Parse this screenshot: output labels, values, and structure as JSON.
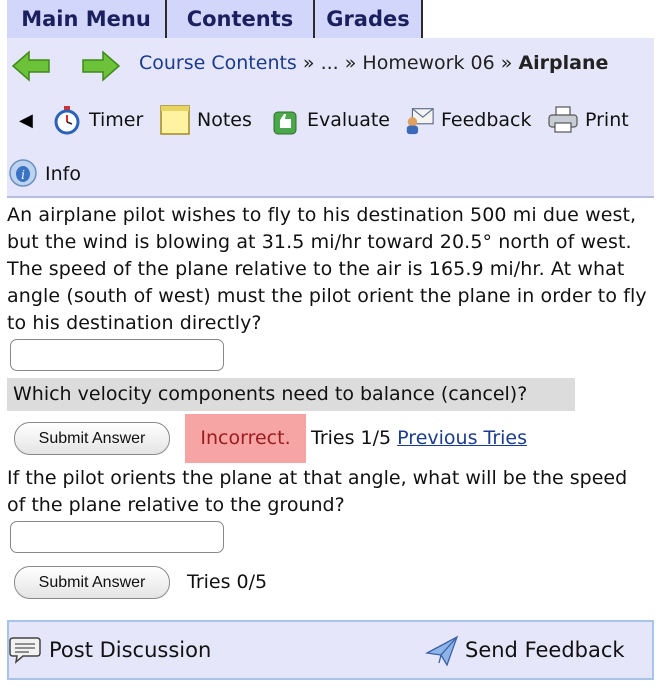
{
  "menu": {
    "tabs": [
      {
        "label": "Main Menu"
      },
      {
        "label": "Contents"
      },
      {
        "label": "Grades"
      }
    ]
  },
  "nav": {
    "back_icon": "green-left-arrow-icon",
    "forward_icon": "green-right-arrow-icon",
    "breadcrumb": {
      "root": "Course Contents",
      "sep": "»",
      "ellipsis": "...",
      "parent": "Homework 06",
      "current": "Airplane"
    },
    "tools": [
      {
        "label": "Timer",
        "icon": "stopwatch-icon"
      },
      {
        "label": "Notes",
        "icon": "note-icon"
      },
      {
        "label": "Evaluate",
        "icon": "thumbs-up-icon"
      },
      {
        "label": "Feedback",
        "icon": "feedback-icon"
      },
      {
        "label": "Print",
        "icon": "printer-icon"
      }
    ],
    "collapse_glyph": "◀",
    "info": {
      "label": "Info",
      "icon": "info-icon"
    }
  },
  "problem": {
    "question1": "An airplane pilot wishes to fly to his destination 500 mi due west, but the wind is blowing at 31.5 mi/hr toward 20.5° north of west. The speed of the plane relative to the air is 165.9 mi/hr. At what angle (south of west) must the pilot orient the plane in order to fly to his destination directly?",
    "answer1_value": "",
    "hint": "Which velocity components need to balance (cancel)?",
    "submit_label": "Submit Answer",
    "status1": "Incorrect.",
    "tries1": "Tries 1/5",
    "previous_tries": "Previous Tries",
    "question2": "If the pilot orients the plane at that angle, what will be the speed of the plane relative to the ground?",
    "answer2_value": "",
    "tries2": "Tries 0/5"
  },
  "footer": {
    "post_discussion": "Post Discussion",
    "post_icon": "discussion-icon",
    "send_feedback": "Send Feedback",
    "send_icon": "send-feedback-icon"
  },
  "colors": {
    "tab_bg": "#d2d6fa",
    "panel_bg": "#e6e6fb",
    "link": "#1b3b8f",
    "incorrect_bg": "#f6a4a4",
    "incorrect_text": "#9a1c1c",
    "arrow_green": "#6cc238"
  }
}
